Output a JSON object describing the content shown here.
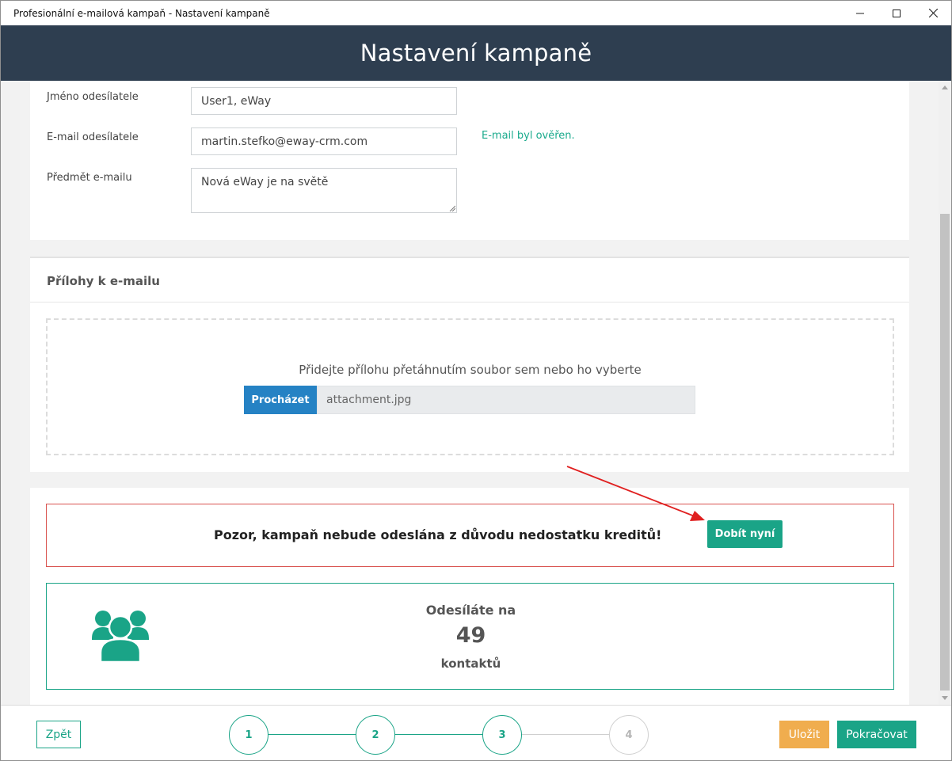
{
  "window": {
    "title": "Profesionální e-mailová kampaň - Nastavení kampaně",
    "minimize_icon": "minimize-icon",
    "maximize_icon": "maximize-icon",
    "close_icon": "close-icon"
  },
  "header": {
    "title": "Nastavení kampaně"
  },
  "sender_form": {
    "sender_name_label": "Jméno odesílatele",
    "sender_name_value": "User1, eWay",
    "sender_email_label": "E-mail odesílatele",
    "sender_email_value": "martin.stefko@eway-crm.com",
    "email_verified_text": "E-mail byl ověřen.",
    "subject_label": "Předmět e-mailu",
    "subject_value": "Nová eWay je na světě"
  },
  "attachments": {
    "title": "Přílohy k e-mailu",
    "dropzone_text": "Přidejte přílohu přetáhnutím soubor sem nebo ho vyberte",
    "browse_label": "Procházet",
    "file_name": "attachment.jpg"
  },
  "credits_alert": {
    "message": "Pozor, kampaň nebude odeslána z důvodu nedostatku kreditů!",
    "topup_label": "Dobít nyní"
  },
  "recipients": {
    "icon": "users-group-icon",
    "sending_to_label": "Odesíláte na",
    "count": "49",
    "contacts_label": "kontaktů"
  },
  "footer": {
    "back_label": "Zpět",
    "steps": [
      {
        "label": "1",
        "state": "done"
      },
      {
        "label": "2",
        "state": "done"
      },
      {
        "label": "3",
        "state": "current"
      },
      {
        "label": "4",
        "state": "todo"
      }
    ],
    "save_label": "Uložit",
    "continue_label": "Pokračovat"
  },
  "colors": {
    "header_bg": "#2e3e50",
    "accent_green": "#1aa487",
    "browse_blue": "#2582c4",
    "alert_red": "#d9534f",
    "save_orange": "#f0ad4e",
    "annotation_red": "#e02020"
  }
}
